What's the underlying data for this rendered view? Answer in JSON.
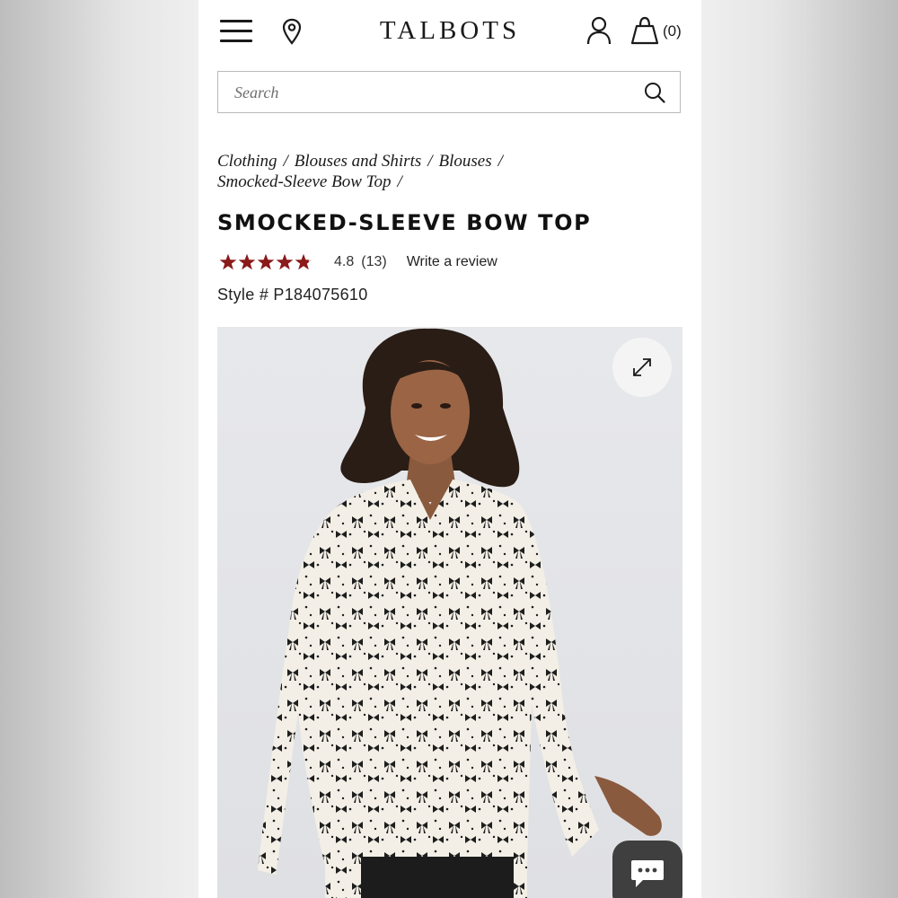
{
  "header": {
    "logo": "TALBOTS",
    "bag_count": "(0)",
    "menu_icon": "hamburger-menu-icon",
    "location_icon": "map-pin-icon",
    "account_icon": "person-icon",
    "bag_icon": "shopping-bag-icon"
  },
  "search": {
    "placeholder": "Search",
    "icon": "search-icon"
  },
  "breadcrumb": {
    "items": [
      "Clothing",
      "Blouses and Shirts",
      "Blouses",
      "Smocked-Sleeve Bow Top"
    ],
    "separator": "/"
  },
  "product": {
    "title": "SMOCKED-SLEEVE BOW TOP",
    "rating_value": "4.8",
    "rating_fraction": 0.96,
    "review_count": "(13)",
    "write_review": "Write a review",
    "style_number": "Style # P184075610",
    "star_color": "#8b1a1a",
    "image_icon": "expand-icon",
    "chat_icon": "chat-icon"
  },
  "colors": {
    "page_bg": "#ffffff",
    "text": "#1a1a1a",
    "star": "#8b1a1a",
    "chat_button": "#3f3f3f"
  }
}
